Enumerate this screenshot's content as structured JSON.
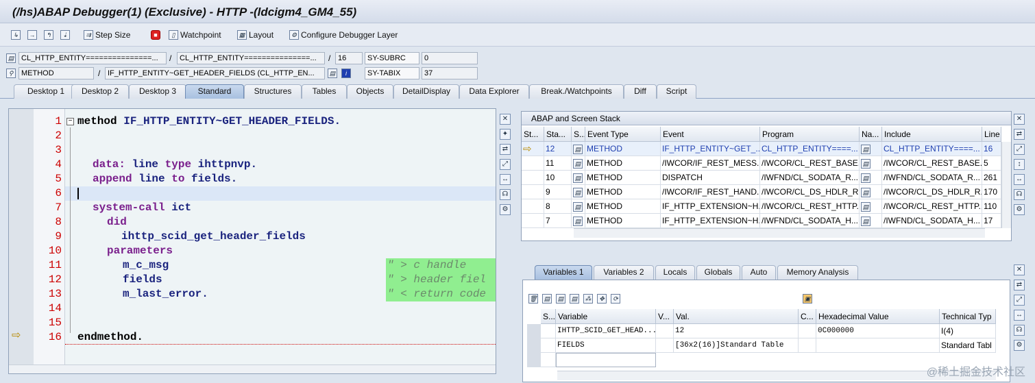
{
  "window": {
    "title": "(/hs)ABAP Debugger(1)  (Exclusive) - HTTP -(ldcigm4_GM4_55)"
  },
  "toolbar": {
    "step_size": "Step Size",
    "watchpoint": "Watchpoint",
    "layout": "Layout",
    "configure": "Configure Debugger Layer"
  },
  "context": {
    "program1": "CL_HTTP_ENTITY===============...",
    "include1": "CL_HTTP_ENTITY===============...",
    "line": "16",
    "sysubrc_label": "SY-SUBRC",
    "sysubrc_value": "0",
    "event_type": "METHOD",
    "event": "IF_HTTP_ENTITY~GET_HEADER_FIELDS (CL_HTTP_EN...",
    "sytabix_label": "SY-TABIX",
    "sytabix_value": "37"
  },
  "tabs": [
    "Desktop 1",
    "Desktop 2",
    "Desktop 3",
    "Standard",
    "Structures",
    "Tables",
    "Objects",
    "DetailDisplay",
    "Data Explorer",
    "Break./Watchpoints",
    "Diff",
    "Script"
  ],
  "active_tab": "Standard",
  "code": {
    "line_numbers": [
      "1",
      "2",
      "3",
      "4",
      "5",
      "6",
      "7",
      "8",
      "9",
      "10",
      "11",
      "12",
      "13",
      "14",
      "15",
      "16"
    ],
    "l1_kw": "method",
    "l1_id": "IF_HTTP_ENTITY~GET_HEADER_FIELDS.",
    "l4_kw": "data:",
    "l4_id": "line",
    "l4_kw2": "type",
    "l4_id2": "ihttpnvp.",
    "l5_kw": "append",
    "l5_id": "line",
    "l5_kw2": "to",
    "l5_id2": "fields.",
    "l7_kw": "system-call",
    "l7_id": "ict",
    "l8_kw": "did",
    "l9_id": "ihttp_scid_get_header_fields",
    "l10_kw": "parameters",
    "l11_id": "m_c_msg",
    "l11_cmt": "\" > c handle",
    "l12_id": "fields",
    "l12_cmt": "\" > header fiel",
    "l13_id": "m_last_error.",
    "l13_cmt": "\" < return code",
    "l16_kw": "endmethod."
  },
  "stack": {
    "title": "ABAP and Screen Stack",
    "headers": [
      "St...",
      "Sta...",
      "S...",
      "Event Type",
      "Event",
      "Program",
      "Na...",
      "Include",
      "Line"
    ],
    "rows": [
      {
        "sta": "12",
        "type": "METHOD",
        "event": "IF_HTTP_ENTITY~GET_...",
        "program": "CL_HTTP_ENTITY====...",
        "include": "CL_HTTP_ENTITY====...",
        "line": "16"
      },
      {
        "sta": "11",
        "type": "METHOD",
        "event": "/IWCOR/IF_REST_MESS...",
        "program": "/IWCOR/CL_REST_BASE...",
        "include": "/IWCOR/CL_REST_BASE...",
        "line": "5"
      },
      {
        "sta": "10",
        "type": "METHOD",
        "event": "DISPATCH",
        "program": "/IWFND/CL_SODATA_R...",
        "include": "/IWFND/CL_SODATA_R...",
        "line": "261"
      },
      {
        "sta": "9",
        "type": "METHOD",
        "event": "/IWCOR/IF_REST_HAND...",
        "program": "/IWCOR/CL_DS_HDLR_R...",
        "include": "/IWCOR/CL_DS_HDLR_R...",
        "line": "170"
      },
      {
        "sta": "8",
        "type": "METHOD",
        "event": "IF_HTTP_EXTENSION~H...",
        "program": "/IWCOR/CL_REST_HTTP...",
        "include": "/IWCOR/CL_REST_HTTP...",
        "line": "110"
      },
      {
        "sta": "7",
        "type": "METHOD",
        "event": "IF_HTTP_EXTENSION~H...",
        "program": "/IWFND/CL_SODATA_H...",
        "include": "/IWFND/CL_SODATA_H...",
        "line": "17"
      }
    ]
  },
  "var_tabs": [
    "Variables 1",
    "Variables 2",
    "Locals",
    "Globals",
    "Auto",
    "Memory Analysis"
  ],
  "vars": {
    "headers": [
      "S...",
      "Variable",
      "V...",
      "Val.",
      "C...",
      "Hexadecimal Value",
      "Technical Typ"
    ],
    "rows": [
      {
        "variable": "IHTTP_SCID_GET_HEAD...",
        "val": "12",
        "hex": "0C000000",
        "type": "I(4)"
      },
      {
        "variable": "FIELDS",
        "val": "[36x2(16)]Standard Table",
        "hex": "",
        "type": "Standard Tabl"
      }
    ]
  },
  "watermark": "@稀土掘金技术社区"
}
